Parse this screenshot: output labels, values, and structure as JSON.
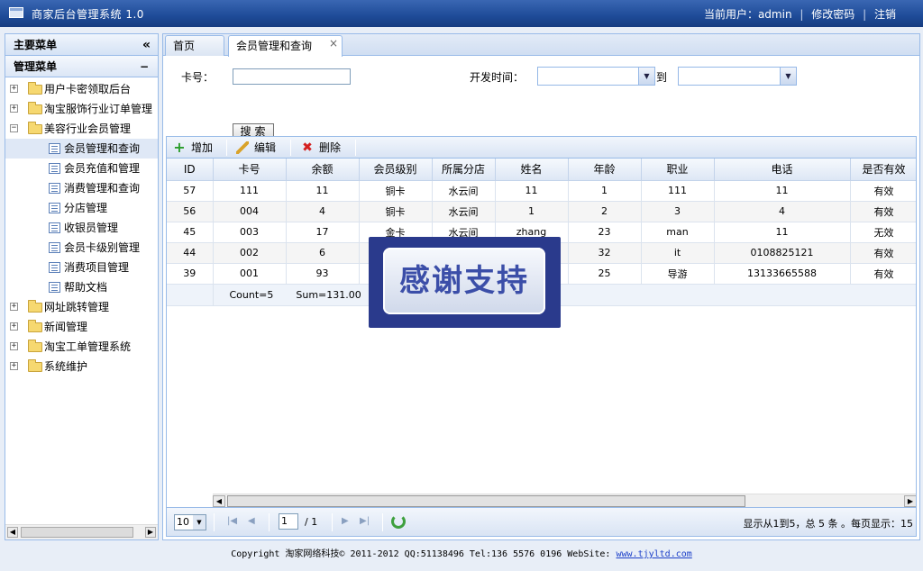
{
  "app": {
    "title": "商家后台管理系统 1.0"
  },
  "userbar": {
    "current_user": "当前用户：admin",
    "change_password": "修改密码",
    "logout": "注销"
  },
  "sidebar": {
    "main_menu": "主要菜单",
    "collapse_icon": "«",
    "manage_menu": "管理菜单",
    "minus_icon": "−",
    "nodes": [
      {
        "label": "用户卡密领取后台"
      },
      {
        "label": "淘宝服饰行业订单管理"
      },
      {
        "label": "美容行业会员管理"
      },
      {
        "label": "网址跳转管理"
      },
      {
        "label": "新闻管理"
      },
      {
        "label": "淘宝工单管理系统"
      },
      {
        "label": "系统维护"
      }
    ],
    "children": [
      {
        "label": "会员管理和查询"
      },
      {
        "label": "会员充值和管理"
      },
      {
        "label": "消费管理和查询"
      },
      {
        "label": "分店管理"
      },
      {
        "label": "收银员管理"
      },
      {
        "label": "会员卡级别管理"
      },
      {
        "label": "消费项目管理"
      },
      {
        "label": "帮助文档"
      }
    ]
  },
  "tabs": [
    {
      "label": "首页"
    },
    {
      "label": "会员管理和查询",
      "close": "×"
    }
  ],
  "search": {
    "card_label": "卡号：",
    "time_label": "开发时间：",
    "to_label": "到",
    "button": "搜索"
  },
  "toolbar": {
    "add": "增加",
    "edit": "编辑",
    "delete": "删除"
  },
  "grid": {
    "columns": [
      "ID",
      "卡号",
      "余额",
      "会员级别",
      "所属分店",
      "姓名",
      "年龄",
      "职业",
      "电话",
      "是否有效"
    ],
    "rows": [
      [
        "57",
        "111",
        "11",
        "铜卡",
        "水云间",
        "11",
        "1",
        "111",
        "11",
        "有效"
      ],
      [
        "56",
        "004",
        "4",
        "铜卡",
        "水云间",
        "1",
        "2",
        "3",
        "4",
        "有效"
      ],
      [
        "45",
        "003",
        "17",
        "金卡",
        "水云间",
        "zhang",
        "23",
        "man",
        "11",
        "无效"
      ],
      [
        "44",
        "002",
        "6",
        "",
        "",
        "",
        "32",
        "it",
        "0108825121",
        "有效"
      ],
      [
        "39",
        "001",
        "93",
        "",
        "",
        "",
        "25",
        "导游",
        "13133665588",
        "有效"
      ]
    ],
    "summary": {
      "count": "Count=5",
      "sum": "Sum=131.00"
    }
  },
  "pager": {
    "page_size": "10",
    "page": "1",
    "total_pages": "/ 1",
    "info": "显示从1到5，总 5 条 。每页显示：15"
  },
  "overlay": {
    "text": "感谢支持"
  },
  "footer": {
    "text": "Copyright 淘家网络科技© 2011-2012 QQ:51138496 Tel:136 5576 0196 WebSite:",
    "link": "www.tjyltd.com"
  }
}
